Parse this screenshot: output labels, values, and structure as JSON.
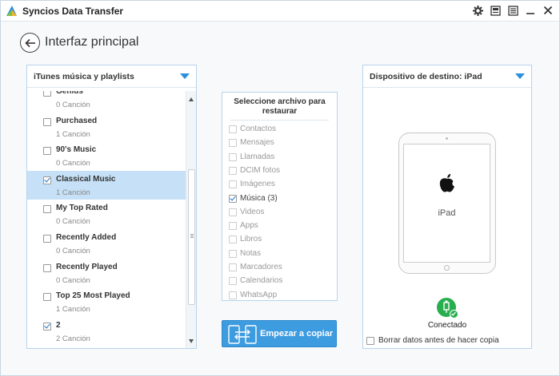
{
  "window": {
    "title": "Syncios Data Transfer"
  },
  "page": {
    "title": "Interfaz principal"
  },
  "source": {
    "header": "iTunes música y playlists",
    "items": [
      {
        "name": "Genius",
        "count": "0 Canción",
        "checked": false,
        "selected": false
      },
      {
        "name": "Purchased",
        "count": "1 Canción",
        "checked": false,
        "selected": false
      },
      {
        "name": "90's Music",
        "count": "0 Canción",
        "checked": false,
        "selected": false
      },
      {
        "name": "Classical Music",
        "count": "1 Canción",
        "checked": true,
        "selected": true
      },
      {
        "name": "My Top Rated",
        "count": "0 Canción",
        "checked": false,
        "selected": false
      },
      {
        "name": "Recently Added",
        "count": "0 Canción",
        "checked": false,
        "selected": false
      },
      {
        "name": "Recently Played",
        "count": "0 Canción",
        "checked": false,
        "selected": false
      },
      {
        "name": "Top 25 Most Played",
        "count": "1 Canción",
        "checked": false,
        "selected": false
      },
      {
        "name": "2",
        "count": "2 Canción",
        "checked": true,
        "selected": false
      }
    ]
  },
  "restore": {
    "header": "Seleccione archivo para restaurar",
    "items": [
      {
        "label": "Contactos",
        "checked": false
      },
      {
        "label": "Mensajes",
        "checked": false
      },
      {
        "label": "Llamadas",
        "checked": false
      },
      {
        "label": "DCIM fotos",
        "checked": false
      },
      {
        "label": "Imágenes",
        "checked": false
      },
      {
        "label": "Música (3)",
        "checked": true
      },
      {
        "label": "Videos",
        "checked": false
      },
      {
        "label": "Apps",
        "checked": false
      },
      {
        "label": "Libros",
        "checked": false
      },
      {
        "label": "Notas",
        "checked": false
      },
      {
        "label": "Marcadores",
        "checked": false
      },
      {
        "label": "Calendarios",
        "checked": false
      },
      {
        "label": "WhatsApp",
        "checked": false
      }
    ]
  },
  "copy_button": {
    "label": "Empezar a copiar"
  },
  "destination": {
    "header": "Dispositivo de destino: iPad",
    "device_label": "iPad",
    "status": "Conectado",
    "erase_label": "Borrar datos antes de hacer copia",
    "erase_checked": false
  },
  "colors": {
    "accent": "#3d9be0",
    "connected": "#27ae4e",
    "selection": "#c6e1f7"
  }
}
